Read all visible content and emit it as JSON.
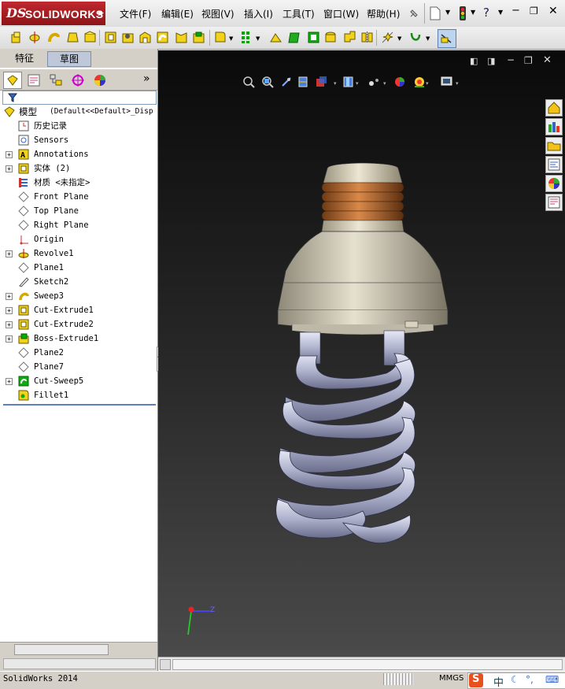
{
  "app": {
    "brand_ds": "DS",
    "brand_name": "SOLIDWORKS"
  },
  "menu": [
    "文件(F)",
    "编辑(E)",
    "视图(V)",
    "插入(I)",
    "工具(T)",
    "窗口(W)",
    "帮助(H)"
  ],
  "panel_tabs": [
    "特征",
    "草图"
  ],
  "tree": {
    "root": {
      "label": "模型",
      "config": "(Default<<Default>_Disp"
    },
    "items": [
      {
        "label": "历史记录",
        "expandable": false,
        "icon": "history-icon"
      },
      {
        "label": "Sensors",
        "expandable": false,
        "icon": "sensor-icon"
      },
      {
        "label": "Annotations",
        "expandable": true,
        "icon": "annotation-icon"
      },
      {
        "label": "实体 (2)",
        "expandable": true,
        "icon": "solid-body-icon"
      },
      {
        "label": "材质 <未指定>",
        "expandable": false,
        "icon": "material-icon"
      },
      {
        "label": "Front Plane",
        "expandable": false,
        "icon": "plane-icon"
      },
      {
        "label": "Top Plane",
        "expandable": false,
        "icon": "plane-icon"
      },
      {
        "label": "Right Plane",
        "expandable": false,
        "icon": "plane-icon"
      },
      {
        "label": "Origin",
        "expandable": false,
        "icon": "origin-icon"
      },
      {
        "label": "Revolve1",
        "expandable": true,
        "icon": "revolve-icon"
      },
      {
        "label": "Plane1",
        "expandable": false,
        "icon": "plane-icon"
      },
      {
        "label": "Sketch2",
        "expandable": false,
        "icon": "sketch-icon"
      },
      {
        "label": "Sweep3",
        "expandable": true,
        "icon": "sweep-icon"
      },
      {
        "label": "Cut-Extrude1",
        "expandable": true,
        "icon": "cut-extrude-icon"
      },
      {
        "label": "Cut-Extrude2",
        "expandable": true,
        "icon": "cut-extrude-icon"
      },
      {
        "label": "Boss-Extrude1",
        "expandable": true,
        "icon": "boss-extrude-icon"
      },
      {
        "label": "Plane2",
        "expandable": false,
        "icon": "plane-icon"
      },
      {
        "label": "Plane7",
        "expandable": false,
        "icon": "plane-icon"
      },
      {
        "label": "Cut-Sweep5",
        "expandable": true,
        "icon": "cut-sweep-icon"
      },
      {
        "label": "Fillet1",
        "expandable": false,
        "icon": "fillet-icon"
      }
    ]
  },
  "viewport": {
    "triad_z": "Z",
    "background_top": "#0a0a0a",
    "background_bottom": "#4a4a4a"
  },
  "status": {
    "app_version": "SolidWorks 2014",
    "units": "MMGS",
    "ime_label": "中"
  },
  "colors": {
    "brand_red": "#b0202a",
    "feature_yellow": "#f2d21a",
    "tube": "#b8bcd4",
    "base": "#d8d2bf",
    "thread": "#b8733a"
  }
}
